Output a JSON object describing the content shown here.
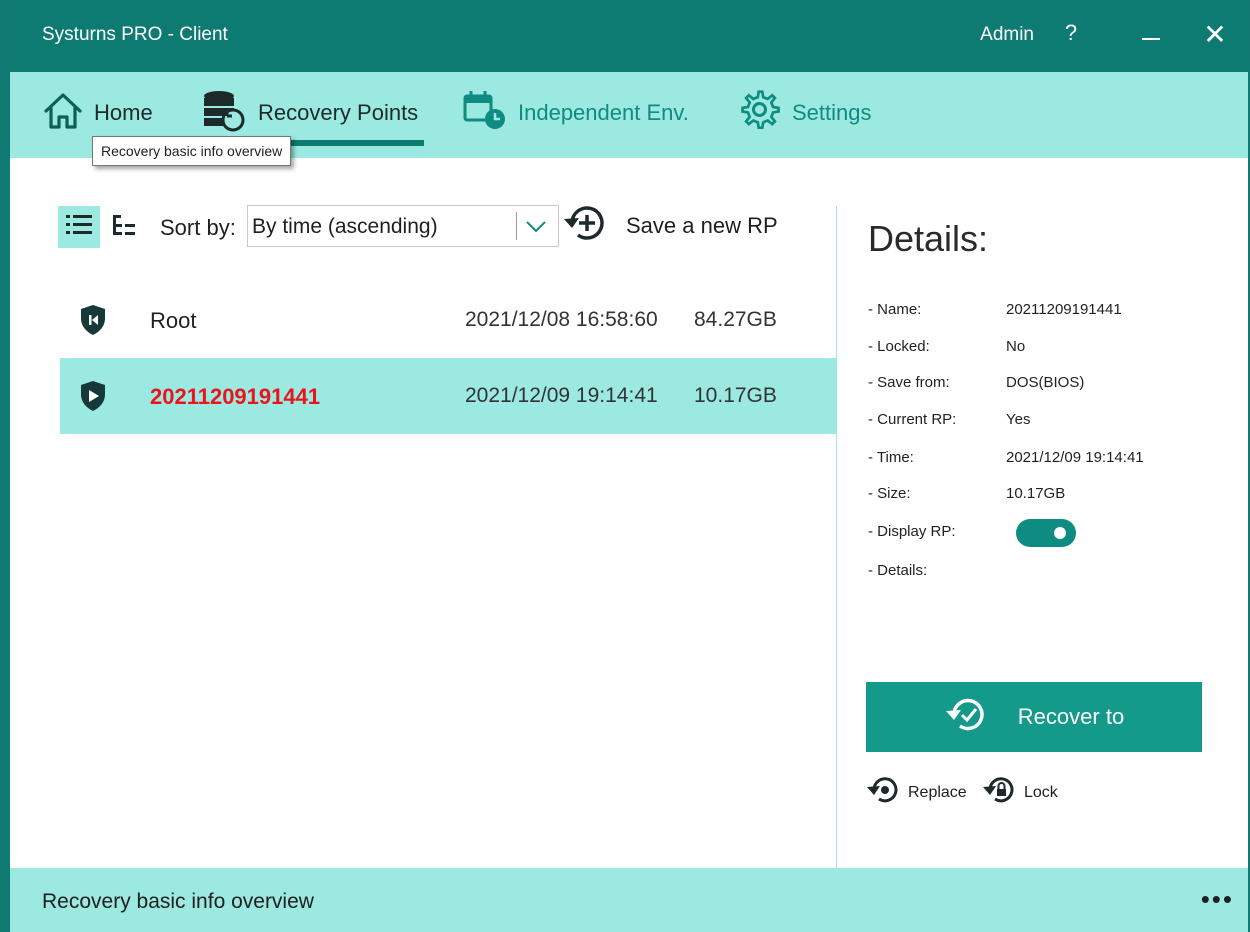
{
  "window": {
    "title": "Systurns PRO - Client",
    "user": "Admin",
    "help_label": "?",
    "close_label": "✕"
  },
  "nav": {
    "items": [
      {
        "label": "Home",
        "icon": "home-icon"
      },
      {
        "label": "Recovery Points",
        "icon": "database-restore-icon",
        "active": true
      },
      {
        "label": "Independent Env.",
        "icon": "calendar-clock-icon"
      },
      {
        "label": "Settings",
        "icon": "gear-icon"
      }
    ],
    "tooltip": "Recovery basic info overview"
  },
  "toolbar": {
    "sort_label": "Sort by:",
    "sort_value": "By time (ascending)",
    "save_label": "Save a new RP"
  },
  "recovery_points": [
    {
      "name": "Root",
      "time": "2021/12/08 16:58:60",
      "size": "84.27GB",
      "selected": false,
      "current": false,
      "icon": "shield-start-icon"
    },
    {
      "name": "20211209191441",
      "time": "2021/12/09 19:14:41",
      "size": "10.17GB",
      "selected": true,
      "current": true,
      "icon": "shield-play-icon"
    }
  ],
  "details": {
    "title": "Details:",
    "fields": [
      {
        "label": "- Name:",
        "value": "20211209191441"
      },
      {
        "label": "- Locked:",
        "value": "No"
      },
      {
        "label": "- Save from:",
        "value": "DOS(BIOS)"
      },
      {
        "label": "- Current RP:",
        "value": "Yes"
      },
      {
        "label": "- Time:",
        "value": "2021/12/09 19:14:41"
      },
      {
        "label": "- Size:",
        "value": "10.17GB"
      },
      {
        "label": "- Display RP:",
        "value": ""
      },
      {
        "label": "- Details:",
        "value": ""
      }
    ],
    "display_rp_on": true,
    "recover_label": "Recover to",
    "replace_label": "Replace",
    "lock_label": "Lock"
  },
  "status": {
    "text": "Recovery basic info overview",
    "more": "•••"
  },
  "colors": {
    "primary": "#0e7b72",
    "accent": "#9be9e0",
    "button": "#139a8b",
    "current_rp": "#e8161c"
  }
}
